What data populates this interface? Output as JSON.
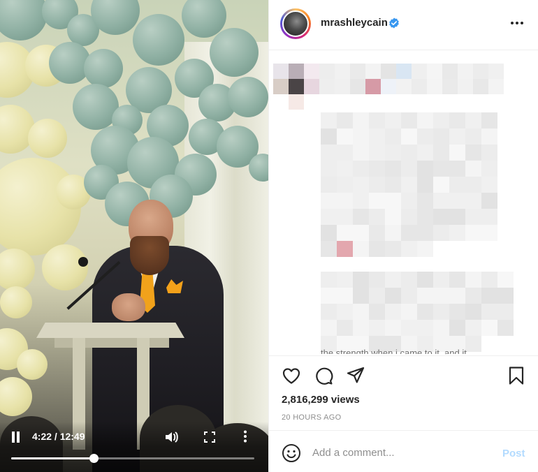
{
  "video": {
    "time_display": "4:22 / 12:49",
    "progress_fraction": 0.34,
    "play_state": "playing"
  },
  "post": {
    "username": "mrashleycain",
    "verified": true,
    "caption_visible_fragment": "the strength when i came to it, and it",
    "views": "2,816,299 views",
    "posted_ago": "20 HOURS AGO"
  },
  "comment_box": {
    "placeholder": "Add a comment...",
    "post_label": "Post"
  },
  "colors": {
    "verified_blue": "#3897f0",
    "post_disabled": "#b3dbff",
    "muted_text": "#8e8e8e"
  },
  "icons": [
    "pause-icon",
    "volume-icon",
    "fullscreen-icon",
    "more-vertical-icon",
    "verified-icon",
    "more-options-icon",
    "heart-icon",
    "comment-icon",
    "share-icon",
    "bookmark-icon",
    "emoji-icon"
  ]
}
